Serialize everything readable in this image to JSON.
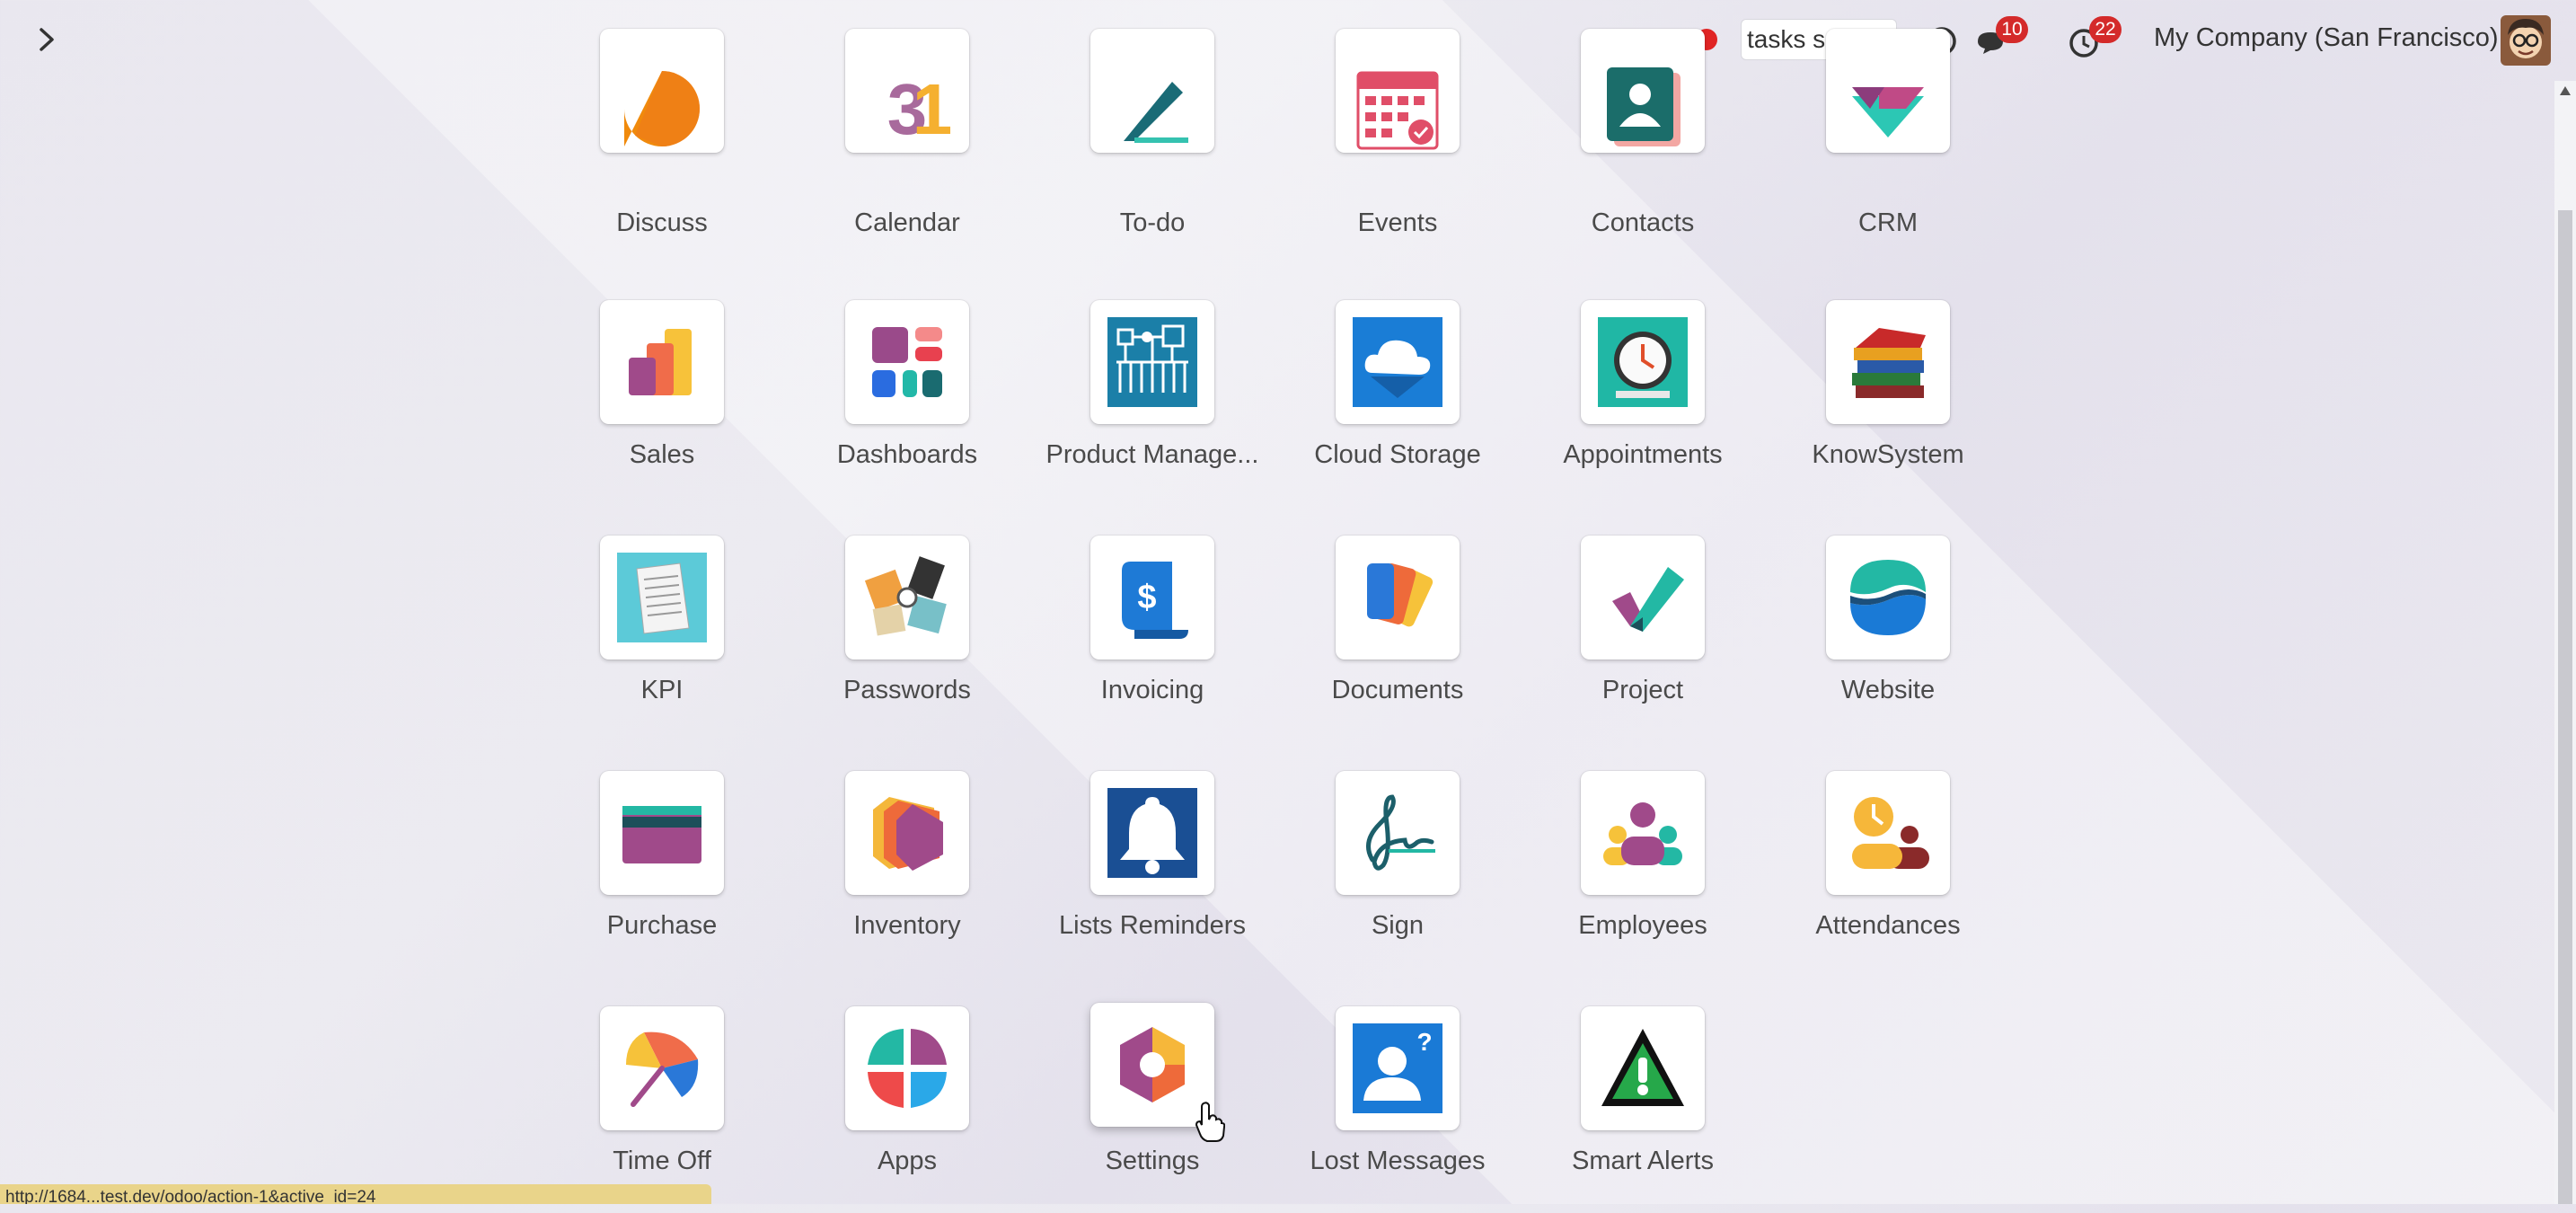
{
  "topbar": {
    "search_value": "tasks search",
    "messages_count": "10",
    "activities_count": "22",
    "company": "My Company (San Francisco)"
  },
  "apps": [
    {
      "label": "Discuss",
      "icon": "discuss-icon"
    },
    {
      "label": "Calendar",
      "icon": "calendar-icon"
    },
    {
      "label": "To-do",
      "icon": "todo-icon"
    },
    {
      "label": "Events",
      "icon": "events-icon"
    },
    {
      "label": "Contacts",
      "icon": "contacts-icon"
    },
    {
      "label": "CRM",
      "icon": "crm-icon"
    },
    {
      "label": "Sales",
      "icon": "sales-icon"
    },
    {
      "label": "Dashboards",
      "icon": "dashboards-icon"
    },
    {
      "label": "Product Manage...",
      "icon": "product-management-icon"
    },
    {
      "label": "Cloud Storage",
      "icon": "cloud-storage-icon"
    },
    {
      "label": "Appointments",
      "icon": "appointments-icon"
    },
    {
      "label": "KnowSystem",
      "icon": "knowsystem-icon"
    },
    {
      "label": "KPI",
      "icon": "kpi-icon"
    },
    {
      "label": "Passwords",
      "icon": "passwords-icon"
    },
    {
      "label": "Invoicing",
      "icon": "invoicing-icon"
    },
    {
      "label": "Documents",
      "icon": "documents-icon"
    },
    {
      "label": "Project",
      "icon": "project-icon"
    },
    {
      "label": "Website",
      "icon": "website-icon"
    },
    {
      "label": "Purchase",
      "icon": "purchase-icon"
    },
    {
      "label": "Inventory",
      "icon": "inventory-icon"
    },
    {
      "label": "Lists Reminders",
      "icon": "bell-icon"
    },
    {
      "label": "Sign",
      "icon": "sign-icon"
    },
    {
      "label": "Employees",
      "icon": "employees-icon"
    },
    {
      "label": "Attendances",
      "icon": "attendances-icon"
    },
    {
      "label": "Time Off",
      "icon": "time-off-icon"
    },
    {
      "label": "Apps",
      "icon": "apps-icon"
    },
    {
      "label": "Settings",
      "icon": "settings-icon"
    },
    {
      "label": "Lost Messages",
      "icon": "lost-messages-icon"
    },
    {
      "label": "Smart Alerts",
      "icon": "smart-alerts-icon"
    }
  ],
  "status_url": "http://1684...test.dev/odoo/action-1&active_id=24"
}
